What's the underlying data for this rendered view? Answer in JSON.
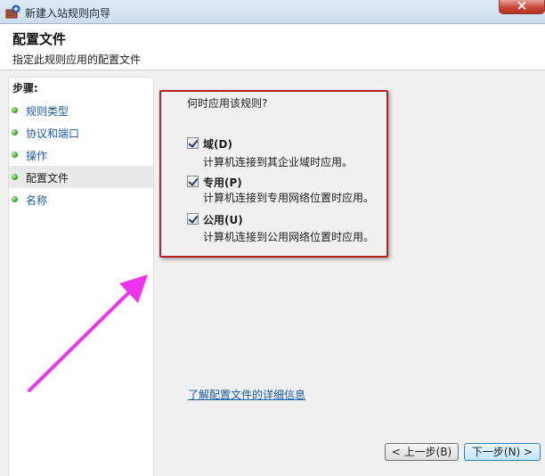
{
  "window": {
    "title": "新建入站规则向导"
  },
  "header": {
    "title": "配置文件",
    "subtitle": "指定此规则应用的配置文件"
  },
  "sidebar": {
    "heading": "步骤:",
    "items": [
      {
        "label": "规则类型"
      },
      {
        "label": "协议和端口"
      },
      {
        "label": "操作"
      },
      {
        "label": "配置文件"
      },
      {
        "label": "名称"
      }
    ],
    "active_index": 3
  },
  "main": {
    "question": "何时应用该规则?",
    "options": [
      {
        "title": "域(D)",
        "description": "计算机连接到其企业域时应用。",
        "checked": true
      },
      {
        "title": "专用(P)",
        "description": "计算机连接到专用网络位置时应用。",
        "checked": true
      },
      {
        "title": "公用(U)",
        "description": "计算机连接到公用网络位置时应用。",
        "checked": true
      }
    ],
    "learn_more_link": "了解配置文件的详细信息"
  },
  "buttons": {
    "back": "< 上一步(B)",
    "next": "下一步(N) >"
  },
  "colors": {
    "highlight_box": "#b22222",
    "annotation_arrow": "#ee33ee",
    "link": "#1a5aa8",
    "step_dot": "#3aa52a"
  },
  "icons": {
    "app": "firewall-wizard-icon",
    "close": "close-icon",
    "step": "green-dot-icon",
    "annotation": "arrow-icon",
    "option": "checkbox-checked-icon"
  }
}
